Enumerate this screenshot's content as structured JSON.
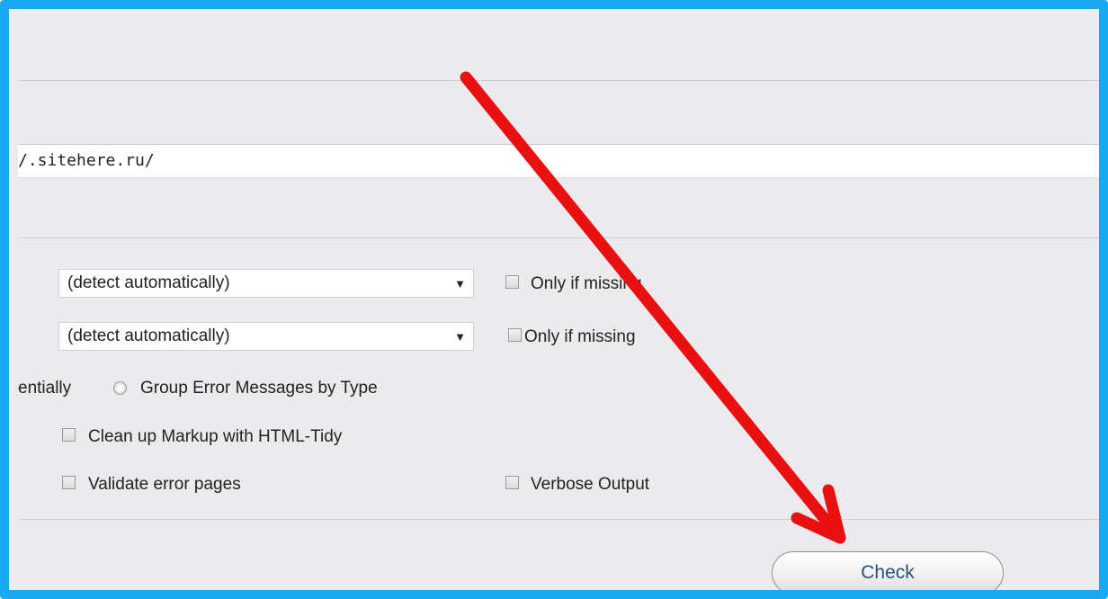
{
  "form": {
    "url_value": "/.sitehere.ru/",
    "charset_select": {
      "selected": "(detect automatically)"
    },
    "charset_only_if_missing_label": "Only if missing",
    "doctype_select": {
      "selected": "(detect automatically)"
    },
    "doctype_only_if_missing_label": "Only if missing",
    "list_messages_sequentially_label": "entially",
    "group_error_messages_label": "Group Error Messages by Type",
    "clean_up_markup_label": "Clean up Markup with HTML-Tidy",
    "validate_error_pages_label": "Validate error pages",
    "verbose_output_label": "Verbose Output",
    "check_button_label": "Check"
  },
  "annotation": {
    "arrow_color": "#e81010",
    "frame_color": "#1aa8ee"
  },
  "icons": {
    "select_arrow": "dropdown-arrow-icon",
    "annotation": "red-arrow-icon"
  }
}
